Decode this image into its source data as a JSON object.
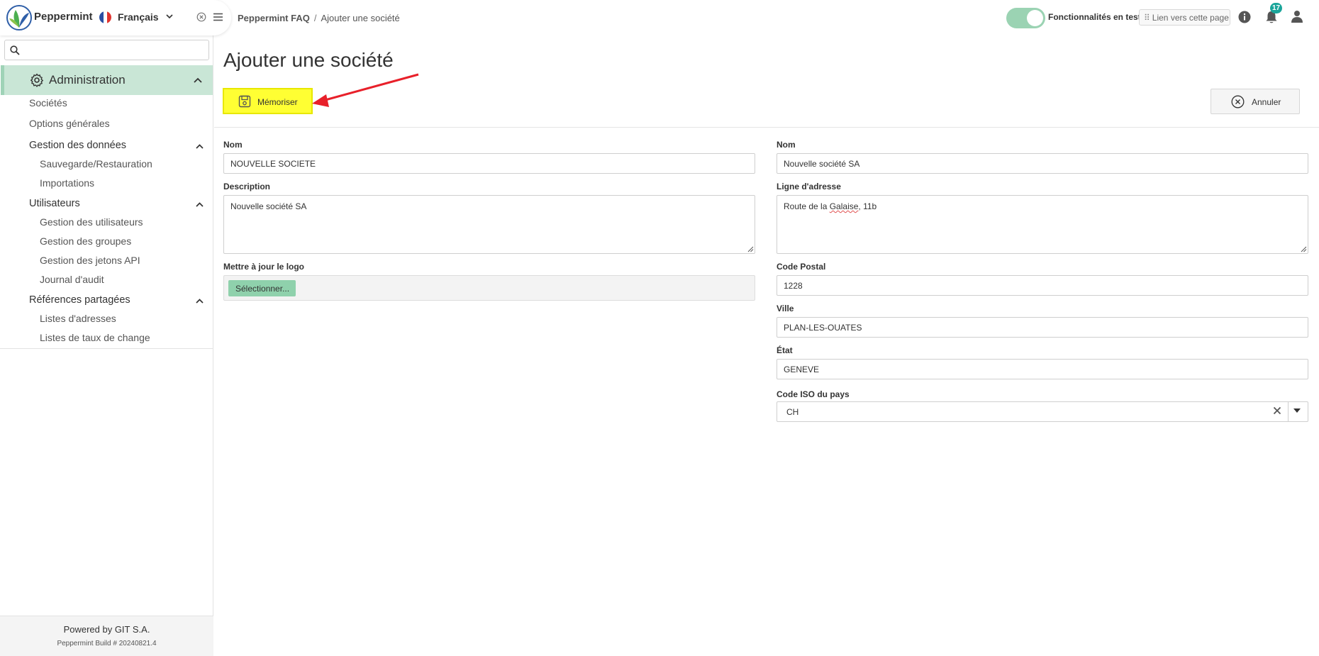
{
  "app": {
    "name": "Peppermint",
    "language": "Français"
  },
  "sidebar": {
    "search_placeholder": "",
    "section": {
      "title": "Administration",
      "items": [
        {
          "label": "Sociétés"
        },
        {
          "label": "Options générales"
        }
      ],
      "groups": [
        {
          "title": "Gestion des données",
          "items": [
            "Sauvegarde/Restauration",
            "Importations"
          ]
        },
        {
          "title": "Utilisateurs",
          "items": [
            "Gestion des utilisateurs",
            "Gestion des groupes",
            "Gestion des jetons API",
            "Journal d'audit"
          ]
        },
        {
          "title": "Références partagées",
          "items": [
            "Listes d'adresses",
            "Listes de taux de change"
          ]
        }
      ]
    },
    "footer": {
      "powered_by": "Powered by GIT S.A.",
      "build": "Peppermint Build # 20240821.4"
    }
  },
  "topbar": {
    "breadcrumb": {
      "root": "Peppermint FAQ",
      "separator": "/",
      "current": "Ajouter une société"
    },
    "feature_toggle_label": "Fonctionnalités en test",
    "feature_toggle_on": true,
    "link_button": "Lien vers cette page",
    "notification_count": "17",
    "accent_color": "#1aa59a"
  },
  "page": {
    "title": "Ajouter une société",
    "save_button": "Mémoriser",
    "cancel_button": "Annuler",
    "left": {
      "name_label": "Nom",
      "name_value": "NOUVELLE SOCIETE",
      "description_label": "Description",
      "description_value": "Nouvelle société SA",
      "logo_label": "Mettre à jour le logo",
      "logo_button": "Sélectionner..."
    },
    "right": {
      "name_label": "Nom",
      "name_value": "Nouvelle société SA",
      "address_label": "Ligne d'adresse",
      "address_value_pre": "Route de la ",
      "address_value_word": "Galaise",
      "address_value_post": ", 11b",
      "postal_label": "Code Postal",
      "postal_value": "1228",
      "city_label": "Ville",
      "city_value": "PLAN-LES-OUATES",
      "state_label": "État",
      "state_value": "GENEVE",
      "country_label": "Code ISO du pays",
      "country_value": "CH"
    }
  },
  "colors": {
    "nav_active_bg": "#c9e6d6",
    "highlight_yellow": "#ffff33",
    "annotation_arrow": "#e8202a",
    "select_button_green": "#8fd1ac"
  }
}
